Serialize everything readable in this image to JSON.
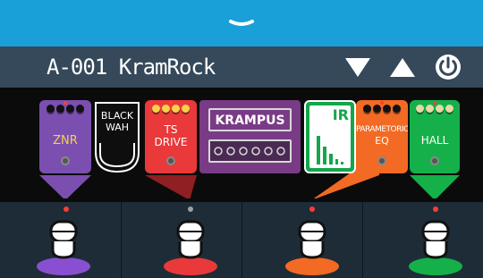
{
  "header": {
    "patch_name": "A-001 KramRock",
    "collapse_icon": "chevron-down-icon",
    "patch_down_icon": "triangle-down-icon",
    "patch_up_icon": "triangle-up-icon",
    "power_icon": "power-icon"
  },
  "colors": {
    "top_bar": "#1aa0d8",
    "title_bar": "#35495a",
    "stomp_area": "#1e2c38",
    "znr": "#7b4fb0",
    "ts_drive": "#e9393b",
    "krampus": "#7a3b86",
    "ir": "#14a64a",
    "parametric_eq": "#f26a23",
    "hall": "#15b04a"
  },
  "effects": [
    {
      "name": "ZNR",
      "color": "#7b4fb0",
      "state": "on"
    },
    {
      "name": "BLACK WAH",
      "color": "#0e0e0e",
      "state": "off"
    },
    {
      "name": "TS DRIVE",
      "color": "#e9393b",
      "state": "on"
    },
    {
      "name": "KRAMPUS",
      "color": "#7a3b86",
      "state": "off"
    },
    {
      "name": "IR",
      "color": "#14a64a",
      "state": "off"
    },
    {
      "name": "PARAMETORIC EQ",
      "color": "#f26a23",
      "state": "on"
    },
    {
      "name": "HALL",
      "color": "#15b04a",
      "state": "on"
    }
  ],
  "pedals": {
    "znr": "ZNR",
    "black_wah_1": "BLACK",
    "black_wah_2": "WAH",
    "ts_drive_1": "TS",
    "ts_drive_2": "DRIVE",
    "krampus": "KRAMPUS",
    "ir": "IR",
    "parametric_1": "PARAMETORIC",
    "parametric_2": "EQ",
    "hall": "HALL"
  },
  "footswitches": [
    {
      "assigned": "ZNR",
      "color": "#8a4fd0",
      "led": "#ff3d2e"
    },
    {
      "assigned": "TS DRIVE",
      "color": "#e9393b",
      "led": "#9aa0a6"
    },
    {
      "assigned": "PARAMETORIC EQ",
      "color": "#f26a23",
      "led": "#ff3d2e"
    },
    {
      "assigned": "HALL",
      "color": "#15b04a",
      "led": "#ff3d2e"
    }
  ]
}
